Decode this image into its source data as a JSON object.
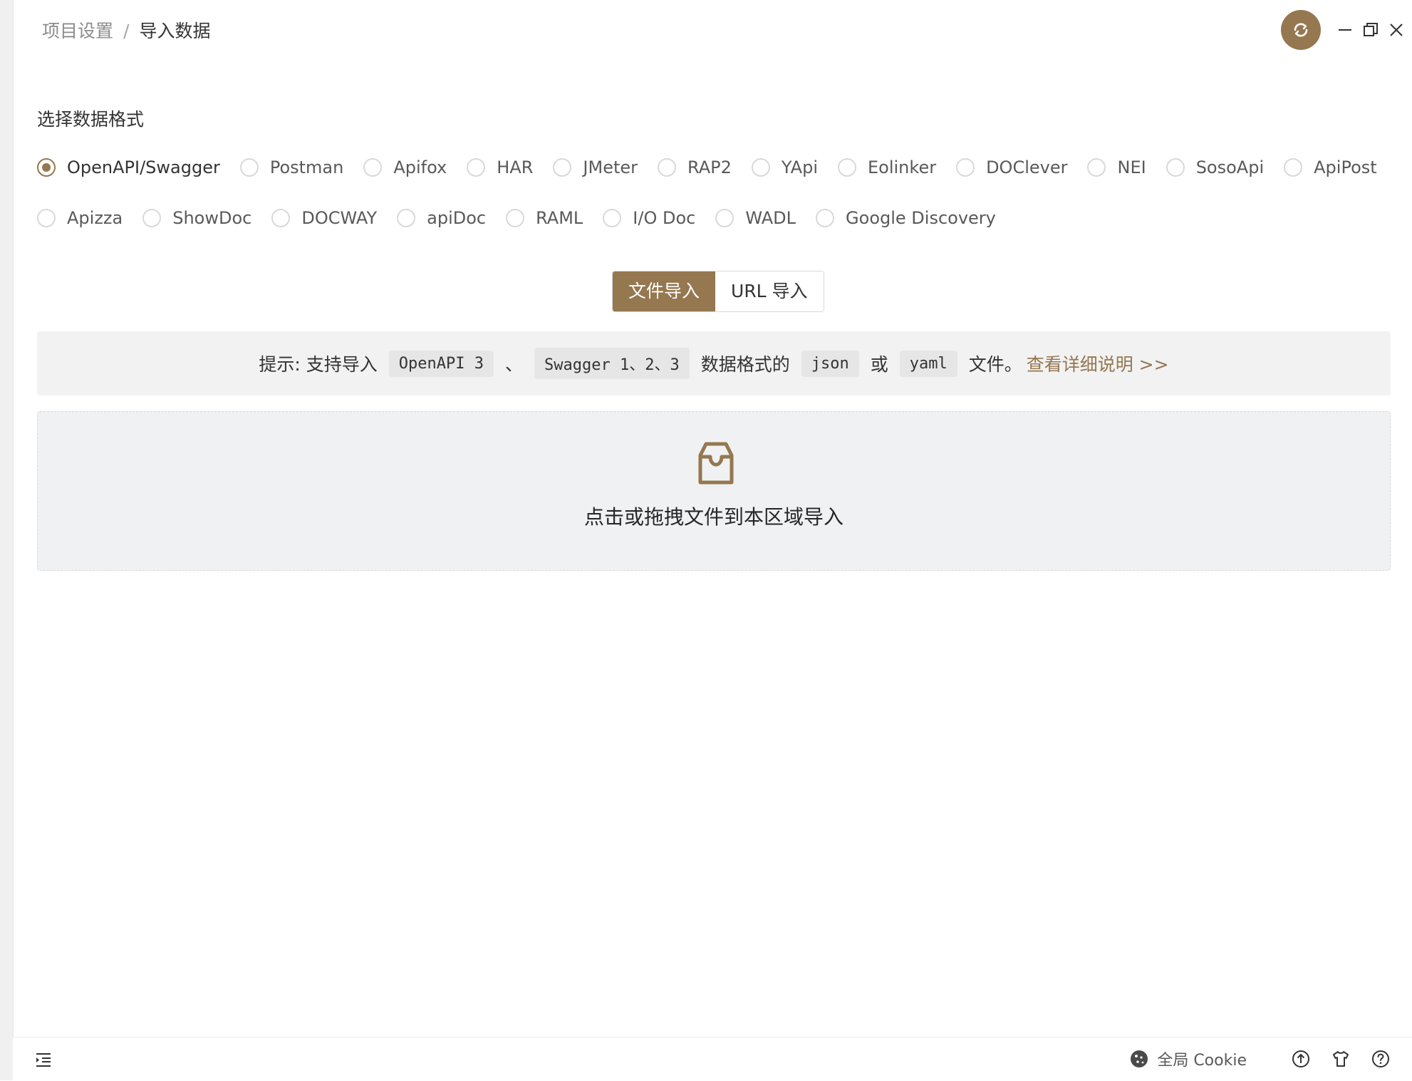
{
  "breadcrumb": {
    "parent": "项目设置",
    "separator": "/",
    "current": "导入数据"
  },
  "colors": {
    "accent": "#957750",
    "tip_bg": "#f2f2f2",
    "dropzone_bg": "#f0f1f2"
  },
  "format": {
    "title": "选择数据格式",
    "selected": "OpenAPI/Swagger",
    "row1": [
      "OpenAPI/Swagger",
      "Postman",
      "Apifox",
      "HAR",
      "JMeter",
      "RAP2",
      "YApi",
      "Eolinker",
      "DOClever",
      "NEI",
      "SosoApi",
      "ApiPost"
    ],
    "row2": [
      "Apizza",
      "ShowDoc",
      "DOCWAY",
      "apiDoc",
      "RAML",
      "I/O Doc",
      "WADL",
      "Google Discovery"
    ]
  },
  "import_mode": {
    "file": "文件导入",
    "url": "URL 导入",
    "active": "file"
  },
  "tip": {
    "prefix": "提示: 支持导入",
    "code1": "OpenAPI 3",
    "sep": "、",
    "code2": "Swagger 1、2、3",
    "mid": "数据格式的",
    "code3": "json",
    "or": "或",
    "code4": "yaml",
    "suffix": "文件。",
    "link": "查看详细说明 >>"
  },
  "dropzone": {
    "icon": "inbox-icon",
    "text": "点击或拖拽文件到本区域导入"
  },
  "footer": {
    "cookie_label": "全局 Cookie",
    "icons": [
      "collapse-menu-icon",
      "cookie-icon",
      "upload-icon",
      "shirt-icon",
      "help-icon"
    ]
  },
  "header_icons": [
    "sync-icon",
    "minimize-icon",
    "restore-icon",
    "close-icon"
  ]
}
